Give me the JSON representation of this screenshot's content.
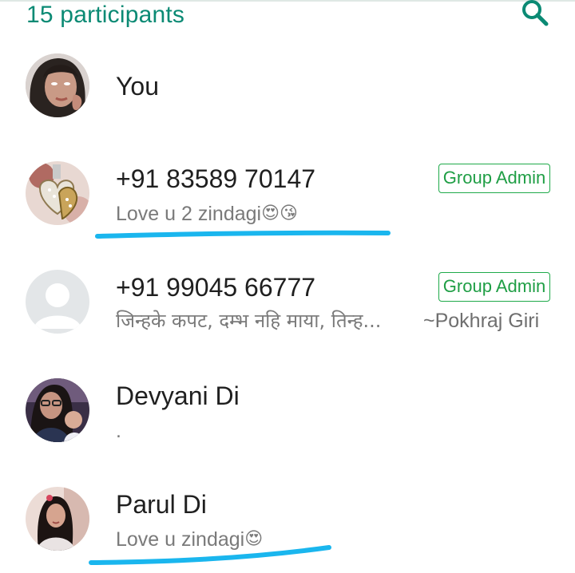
{
  "header": {
    "title": "15 participants",
    "search_icon": "search-icon"
  },
  "participants": [
    {
      "name": "You",
      "status": "",
      "admin": "",
      "pushname": "",
      "emoji": ""
    },
    {
      "name": "+91 83589 70147",
      "status": "Love u 2 zindagi",
      "emoji": "😍😘",
      "admin": "Group Admin",
      "pushname": ""
    },
    {
      "name": "+91 99045 66777",
      "status": "जिन्हके कपट, दम्भ नहि माया, तिन्ह...",
      "emoji": "",
      "admin": "Group Admin",
      "pushname": "~Pokhraj Giri"
    },
    {
      "name": "Devyani Di",
      "status": ".",
      "emoji": "",
      "admin": "",
      "pushname": ""
    },
    {
      "name": "Parul Di",
      "status": "Love u zindagi",
      "emoji": "😍",
      "admin": "",
      "pushname": ""
    }
  ],
  "colors": {
    "accent": "#0b8a74",
    "admin_green": "#1f9e45",
    "annotation_blue": "#1ab6ee"
  }
}
